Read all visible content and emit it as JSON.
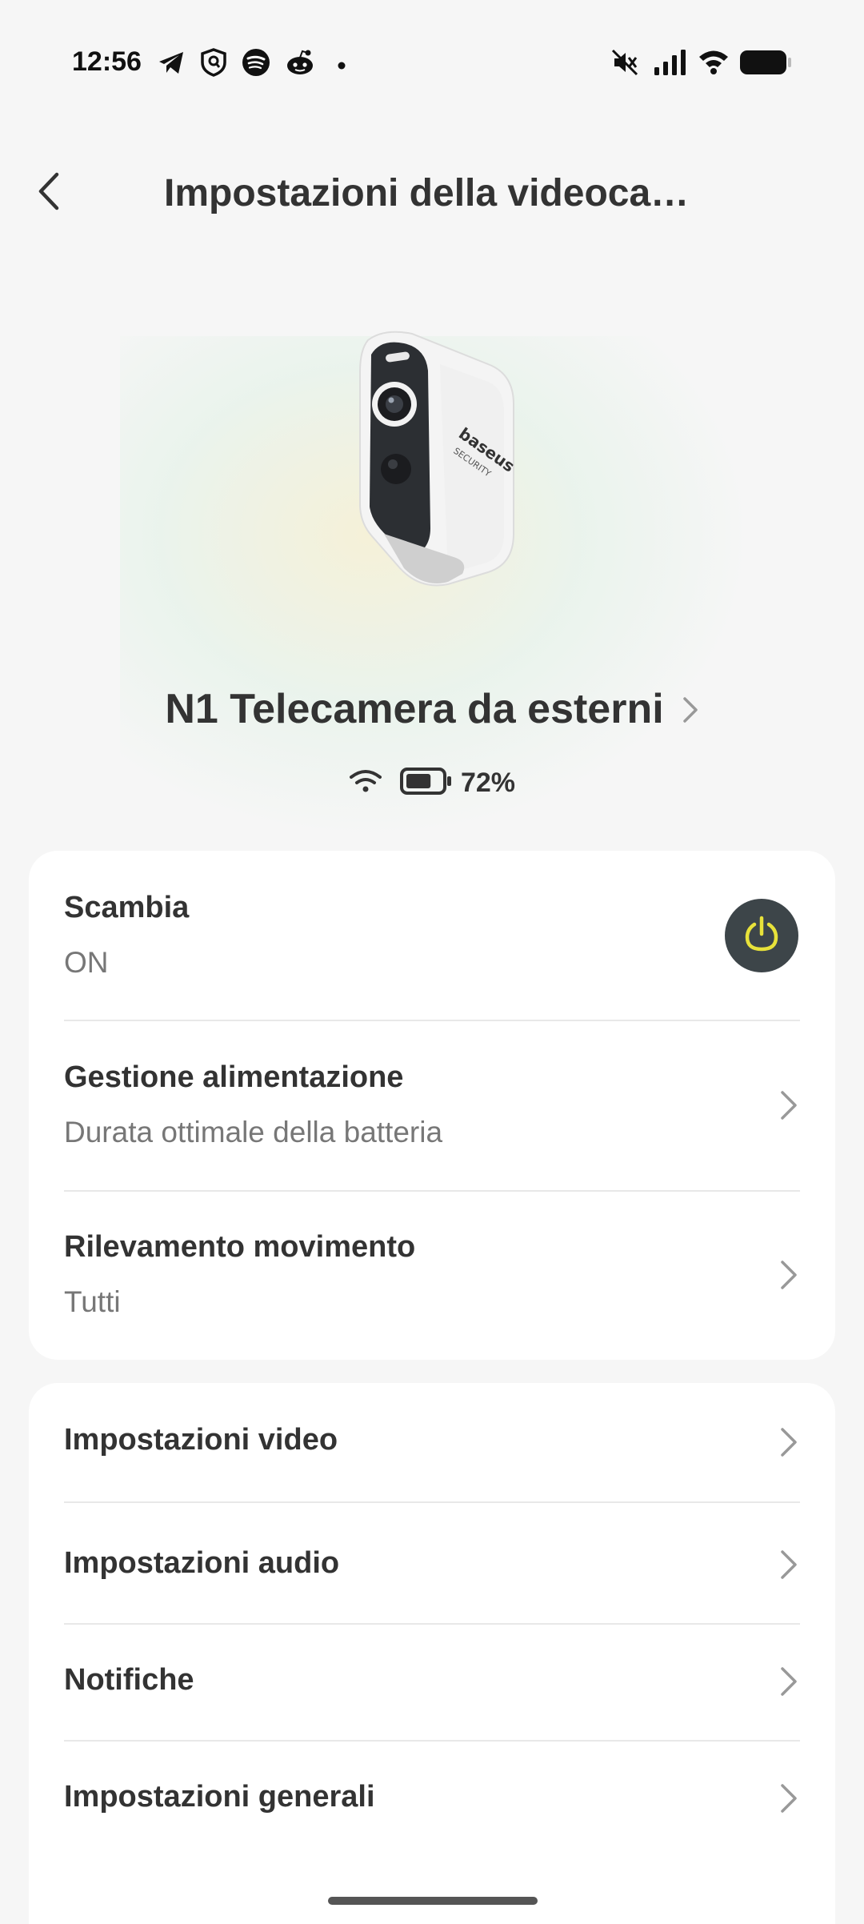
{
  "status_bar": {
    "time": "12:56",
    "left_icons": [
      "telegram-icon",
      "shield-icon",
      "spotify-icon",
      "reddit-icon",
      "dot-icon"
    ],
    "right_icons": [
      "mute-icon",
      "signal-icon",
      "wifi-icon",
      "battery-icon"
    ]
  },
  "header": {
    "back_icon": "chevron-left-icon",
    "title": "Impostazioni della videoca…"
  },
  "device": {
    "name": "N1 Telecamera da esterni",
    "battery_percent": "72%",
    "battery_level": 0.72,
    "camera_brand_text": "baseus SECURITY"
  },
  "settings_card": {
    "items": [
      {
        "title": "Scambia",
        "value": "ON"
      },
      {
        "title": "Gestione alimentazione",
        "value": "Durata ottimale della batteria"
      },
      {
        "title": "Rilevamento movimento",
        "value": "Tutti"
      }
    ]
  },
  "menu_card": {
    "items": [
      {
        "title": "Impostazioni video"
      },
      {
        "title": "Impostazioni audio"
      },
      {
        "title": "Notifiche"
      },
      {
        "title": "Impostazioni generali"
      }
    ]
  },
  "colors": {
    "background": "#f6f6f6",
    "card": "#ffffff",
    "power_button_bg": "#3d4549",
    "power_icon": "#e8e23a",
    "text_primary": "#333333",
    "text_secondary": "#777777"
  }
}
